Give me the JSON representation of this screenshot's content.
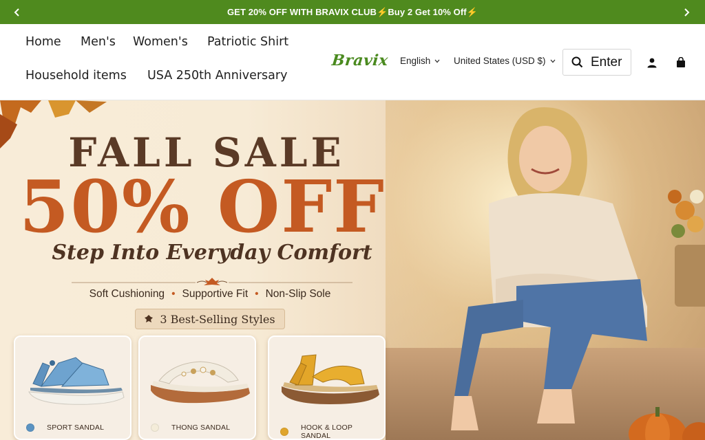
{
  "announcement": {
    "message": "GET 20% OFF WITH BRAVIX CLUB⚡Buy 2 Get 10% Off⚡",
    "prev_icon": "chevron-left-icon",
    "next_icon": "chevron-right-icon"
  },
  "nav": {
    "items": [
      {
        "label": "Home"
      },
      {
        "label": "Men's"
      },
      {
        "label": "Women's"
      },
      {
        "label": "Patriotic Shirt"
      },
      {
        "label": "Household items"
      },
      {
        "label": "USA 250th Anniversary"
      }
    ]
  },
  "header": {
    "logo_text": "Bravix",
    "language": "English",
    "currency": "United States (USD $)",
    "search_label": "Enter",
    "account_icon": "user-icon",
    "cart_icon": "shopping-bag-icon"
  },
  "hero": {
    "headline": "FALL SALE",
    "discount": "50% OFF",
    "tagline": "Step Into Everyday Comfort",
    "features": [
      "Soft Cushioning",
      "Supportive Fit",
      "Non-Slip Sole"
    ],
    "badge": "3 Best-Selling Styles",
    "products": [
      {
        "label": "SPORT SANDAL",
        "swatch": "#5b93c2"
      },
      {
        "label": "THONG SANDAL",
        "swatch": "#f4ecd9"
      },
      {
        "label": "HOOK & LOOP SANDAL",
        "swatch": "#e0a52c"
      }
    ]
  },
  "colors": {
    "brand_green": "#4f8a1e",
    "accent_orange": "#c45a22",
    "heading_brown": "#5a3a26"
  }
}
